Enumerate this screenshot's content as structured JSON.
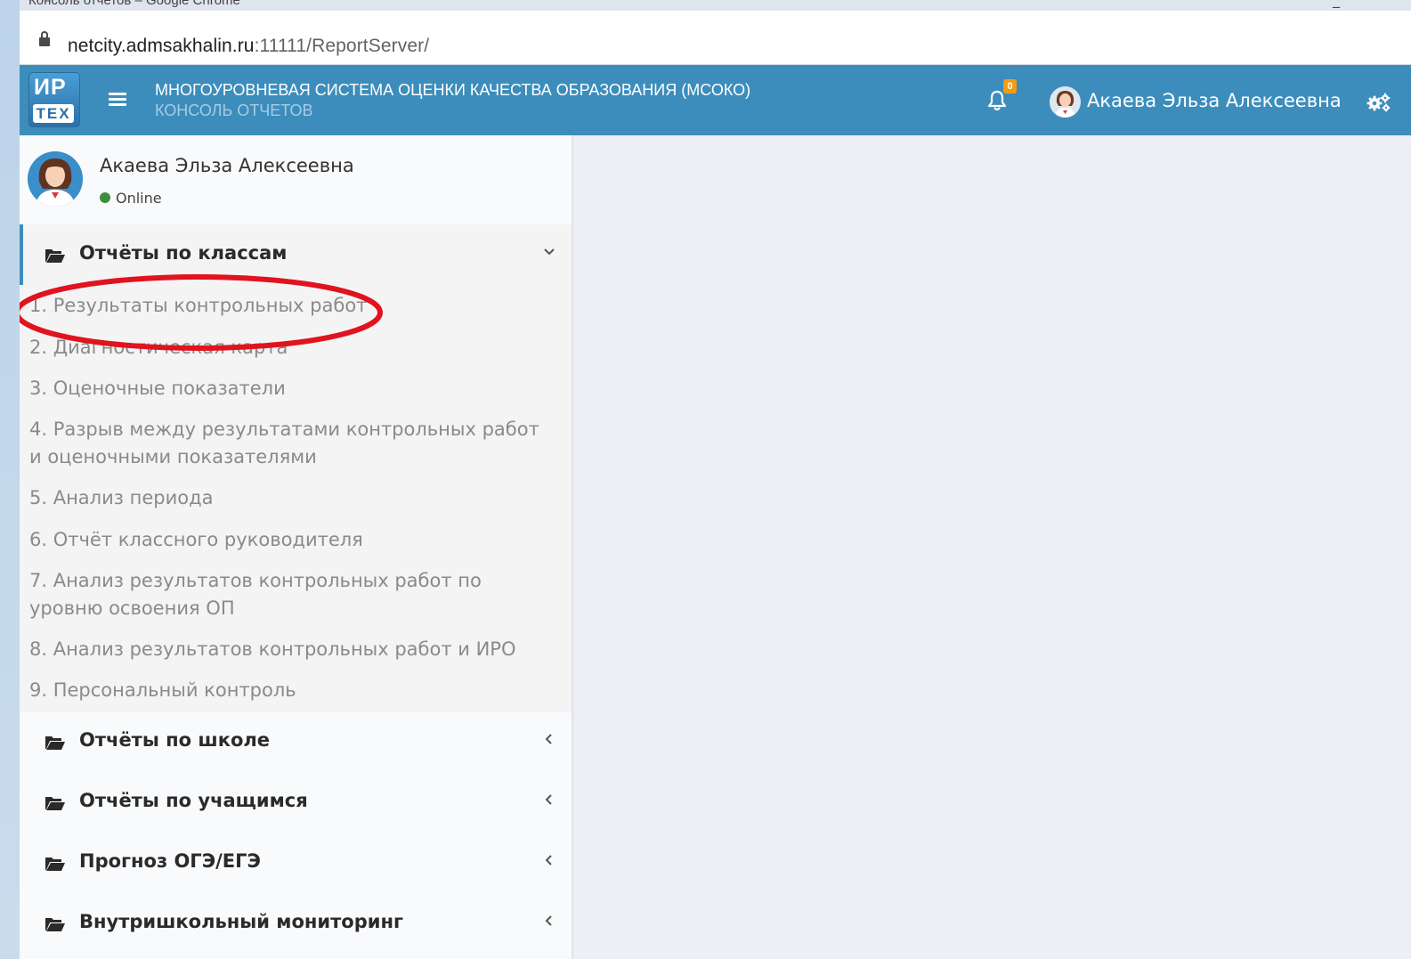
{
  "browser": {
    "tab_title": "Консоль отчетов – Google Chrome",
    "minimize_glyph": "_",
    "url_host": "netcity.admsakhalin.ru",
    "url_rest": ":11111/ReportServer/"
  },
  "header": {
    "logo_top": "ИР",
    "logo_bottom": "ТЕХ",
    "title": "МНОГОУРОВНЕВАЯ СИСТЕМА ОЦЕНКИ КАЧЕСТВА ОБРАЗОВАНИЯ (МСОКО)",
    "subtitle": "КОНСОЛЬ ОТЧЕТОВ",
    "notifications_count": "0",
    "username": "Акаева Эльза Алексеевна",
    "accent_color": "#3c8dbc",
    "badge_color": "#f39c12"
  },
  "sidebar": {
    "user_name": "Акаева Эльза Алексеевна",
    "status": "Online",
    "status_color": "#3d8f3d",
    "open_section": {
      "label": "Отчёты по классам",
      "icon": "folder-open-icon",
      "items": [
        "1. Результаты контрольных работ",
        "2. Диагностическая карта",
        "3. Оценочные показатели",
        "4. Разрыв между результатами контрольных работ и оценочными показателями",
        "5. Анализ периода",
        "6. Отчёт классного руководителя",
        "7. Анализ результатов контрольных работ по уровню освоения ОП",
        "8. Анализ результатов контрольных работ и ИРО",
        "9. Персональный контроль"
      ]
    },
    "collapsed_sections": [
      {
        "label": "Отчёты по школе",
        "icon": "folder-open-icon"
      },
      {
        "label": "Отчёты по учащимся",
        "icon": "folder-open-icon"
      },
      {
        "label": "Прогноз ОГЭ/ЕГЭ",
        "icon": "folder-open-icon"
      },
      {
        "label": "Внутришкольный мониторинг",
        "icon": "folder-open-icon"
      }
    ]
  },
  "annotation": {
    "shape": "ellipse",
    "color": "#e0141e",
    "target": "1. Результаты контрольных работ"
  }
}
